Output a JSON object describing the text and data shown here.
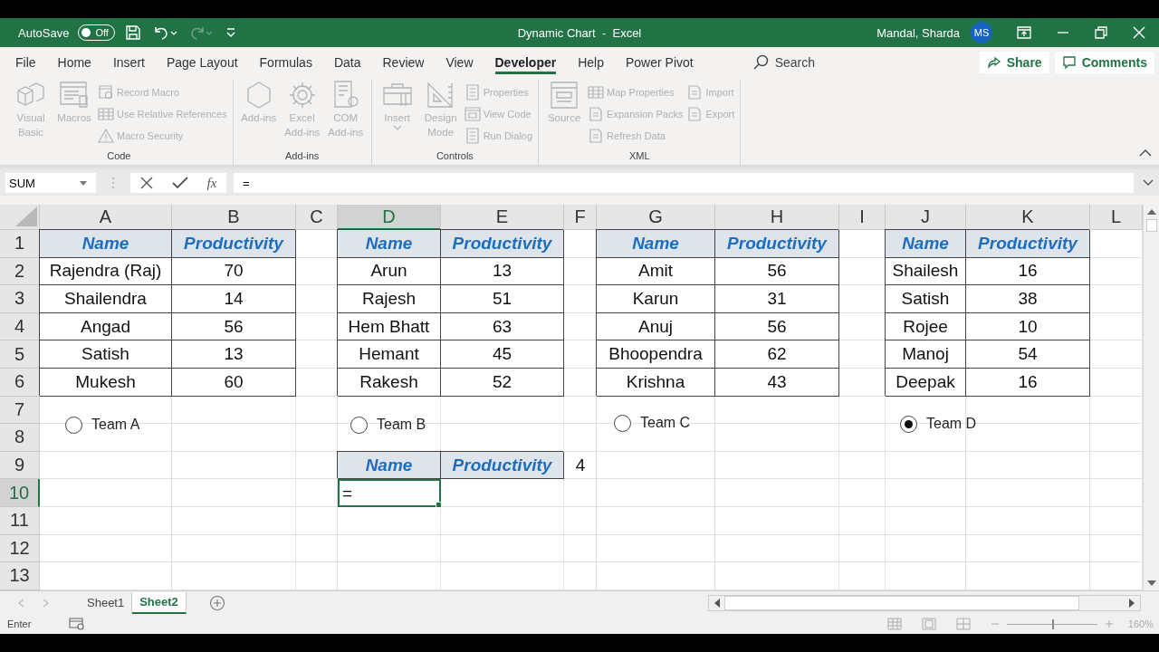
{
  "title_bar": {
    "autosave": {
      "label": "AutoSave",
      "state": "Off",
      "on": false
    },
    "redo": {
      "disabled": true
    },
    "title": "Dynamic Chart  -  Excel",
    "user": "Mandal, Sharda",
    "avatar": "MS"
  },
  "tabs": [
    {
      "label": "File",
      "selected": false
    },
    {
      "label": "Home",
      "selected": false
    },
    {
      "label": "Insert",
      "selected": false
    },
    {
      "label": "Page Layout",
      "selected": false
    },
    {
      "label": "Formulas",
      "selected": false
    },
    {
      "label": "Data",
      "selected": false
    },
    {
      "label": "Review",
      "selected": false
    },
    {
      "label": "View",
      "selected": false
    },
    {
      "label": "Developer",
      "selected": true
    },
    {
      "label": "Help",
      "selected": false
    },
    {
      "label": "Power Pivot",
      "selected": false
    }
  ],
  "search": {
    "placeholder": "Search"
  },
  "share": "Share",
  "comments": "Comments",
  "ribbon": {
    "groups": [
      {
        "label": "Code",
        "large": [
          {
            "label": "Visual Basic",
            "disabled": true,
            "dropdown": false
          },
          {
            "label": "Macros",
            "disabled": true,
            "dropdown": false
          }
        ],
        "small": [
          [
            {
              "label": "Record Macro",
              "disabled": true
            },
            {
              "label": "Use Relative References",
              "disabled": true
            },
            {
              "label": "Macro Security",
              "disabled": true
            }
          ]
        ]
      },
      {
        "label": "Add-ins",
        "large": [
          {
            "label": "Add-ins",
            "disabled": true,
            "dropdown": false
          },
          {
            "label": "Excel Add-ins",
            "disabled": true,
            "dropdown": false
          },
          {
            "label": "COM Add-ins",
            "disabled": true,
            "dropdown": false
          }
        ]
      },
      {
        "label": "Controls",
        "large": [
          {
            "label": "Insert",
            "disabled": true,
            "dropdown": true
          },
          {
            "label": "Design Mode",
            "disabled": true,
            "dropdown": false
          }
        ],
        "small": [
          [
            {
              "label": "Properties",
              "disabled": true
            },
            {
              "label": "View Code",
              "disabled": true
            },
            {
              "label": "Run Dialog",
              "disabled": true
            }
          ]
        ]
      },
      {
        "label": "XML",
        "large": [
          {
            "label": "Source",
            "disabled": true,
            "dropdown": false
          }
        ],
        "small": [
          [
            {
              "label": "Map Properties",
              "disabled": true
            },
            {
              "label": "Expansion Packs",
              "disabled": true
            },
            {
              "label": "Refresh Data",
              "disabled": true
            }
          ],
          [
            {
              "label": "Import",
              "disabled": true
            },
            {
              "label": "Export",
              "disabled": true
            }
          ]
        ]
      }
    ]
  },
  "formula_bar": {
    "name_box": "SUM",
    "fx": "fx",
    "formula": "="
  },
  "sheet": {
    "columns": [
      {
        "label": "A",
        "selected": false
      },
      {
        "label": "B",
        "selected": false
      },
      {
        "label": "C",
        "selected": false
      },
      {
        "label": "D",
        "selected": true
      },
      {
        "label": "E",
        "selected": false
      },
      {
        "label": "F",
        "selected": false
      },
      {
        "label": "G",
        "selected": false
      },
      {
        "label": "H",
        "selected": false
      },
      {
        "label": "I",
        "selected": false
      },
      {
        "label": "J",
        "selected": false
      },
      {
        "label": "K",
        "selected": false
      },
      {
        "label": "L",
        "selected": false
      }
    ],
    "rows": [
      {
        "label": "1",
        "selected": false,
        "cells": [
          {
            "kind": "header",
            "text": "Name"
          },
          {
            "kind": "header",
            "text": "Productivity"
          },
          null,
          {
            "kind": "header",
            "text": "Name"
          },
          {
            "kind": "header",
            "text": "Productivity"
          },
          null,
          {
            "kind": "header",
            "text": "Name"
          },
          {
            "kind": "header",
            "text": "Productivity"
          },
          null,
          {
            "kind": "header",
            "text": "Name"
          },
          {
            "kind": "header",
            "text": "Productivity"
          }
        ]
      },
      {
        "label": "2",
        "selected": false,
        "cells": [
          {
            "kind": "data",
            "text": "Rajendra (Raj)"
          },
          {
            "kind": "data",
            "text": "70"
          },
          null,
          {
            "kind": "data",
            "text": "Arun"
          },
          {
            "kind": "data",
            "text": "13"
          },
          null,
          {
            "kind": "data",
            "text": "Amit"
          },
          {
            "kind": "data",
            "text": "56"
          },
          null,
          {
            "kind": "data",
            "text": "Shailesh"
          },
          {
            "kind": "data",
            "text": "16"
          }
        ]
      },
      {
        "label": "3",
        "selected": false,
        "cells": [
          {
            "kind": "data",
            "text": "Shailendra"
          },
          {
            "kind": "data",
            "text": "14"
          },
          null,
          {
            "kind": "data",
            "text": "Rajesh"
          },
          {
            "kind": "data",
            "text": "51"
          },
          null,
          {
            "kind": "data",
            "text": "Karun"
          },
          {
            "kind": "data",
            "text": "31"
          },
          null,
          {
            "kind": "data",
            "text": "Satish"
          },
          {
            "kind": "data",
            "text": "38"
          }
        ]
      },
      {
        "label": "4",
        "selected": false,
        "cells": [
          {
            "kind": "data",
            "text": "Angad"
          },
          {
            "kind": "data",
            "text": "56"
          },
          null,
          {
            "kind": "data",
            "text": "Hem Bhatt"
          },
          {
            "kind": "data",
            "text": "63"
          },
          null,
          {
            "kind": "data",
            "text": "Anuj"
          },
          {
            "kind": "data",
            "text": "56"
          },
          null,
          {
            "kind": "data",
            "text": "Rojee"
          },
          {
            "kind": "data",
            "text": "10"
          }
        ]
      },
      {
        "label": "5",
        "selected": false,
        "cells": [
          {
            "kind": "data",
            "text": "Satish"
          },
          {
            "kind": "data",
            "text": "13"
          },
          null,
          {
            "kind": "data",
            "text": "Hemant"
          },
          {
            "kind": "data",
            "text": "45"
          },
          null,
          {
            "kind": "data",
            "text": "Bhoopendra"
          },
          {
            "kind": "data",
            "text": "62"
          },
          null,
          {
            "kind": "data",
            "text": "Manoj"
          },
          {
            "kind": "data",
            "text": "54"
          }
        ]
      },
      {
        "label": "6",
        "selected": false,
        "cells": [
          {
            "kind": "data",
            "text": "Mukesh"
          },
          {
            "kind": "data",
            "text": "60"
          },
          null,
          {
            "kind": "data",
            "text": "Rakesh"
          },
          {
            "kind": "data",
            "text": "52"
          },
          null,
          {
            "kind": "data",
            "text": "Krishna"
          },
          {
            "kind": "data",
            "text": "43"
          },
          null,
          {
            "kind": "data",
            "text": "Deepak"
          },
          {
            "kind": "data",
            "text": "16"
          }
        ]
      },
      {
        "label": "7",
        "selected": false,
        "cells": []
      },
      {
        "label": "8",
        "selected": false,
        "cells": []
      },
      {
        "label": "9",
        "selected": false,
        "cells": [
          null,
          null,
          null,
          {
            "kind": "header",
            "text": "Name"
          },
          {
            "kind": "header",
            "text": "Productivity"
          },
          {
            "kind": "plain",
            "text": "4"
          }
        ]
      },
      {
        "label": "10",
        "selected": true,
        "cells": [
          null,
          null,
          null,
          {
            "kind": "editing",
            "text": "="
          }
        ]
      },
      {
        "label": "11",
        "selected": false,
        "cells": []
      },
      {
        "label": "12",
        "selected": false,
        "cells": []
      },
      {
        "label": "13",
        "selected": false,
        "cells": []
      }
    ],
    "options": [
      {
        "label": "Team A",
        "selected": false
      },
      {
        "label": "Team B",
        "selected": false
      },
      {
        "label": "Team C",
        "selected": false
      },
      {
        "label": "Team D",
        "selected": true
      }
    ]
  },
  "sheet_tabs": [
    {
      "label": "Sheet1",
      "selected": false
    },
    {
      "label": "Sheet2",
      "selected": true
    }
  ],
  "status_bar": {
    "mode": "Enter",
    "zoom_slider": {
      "level": 0.5
    },
    "zoom": "160%"
  }
}
